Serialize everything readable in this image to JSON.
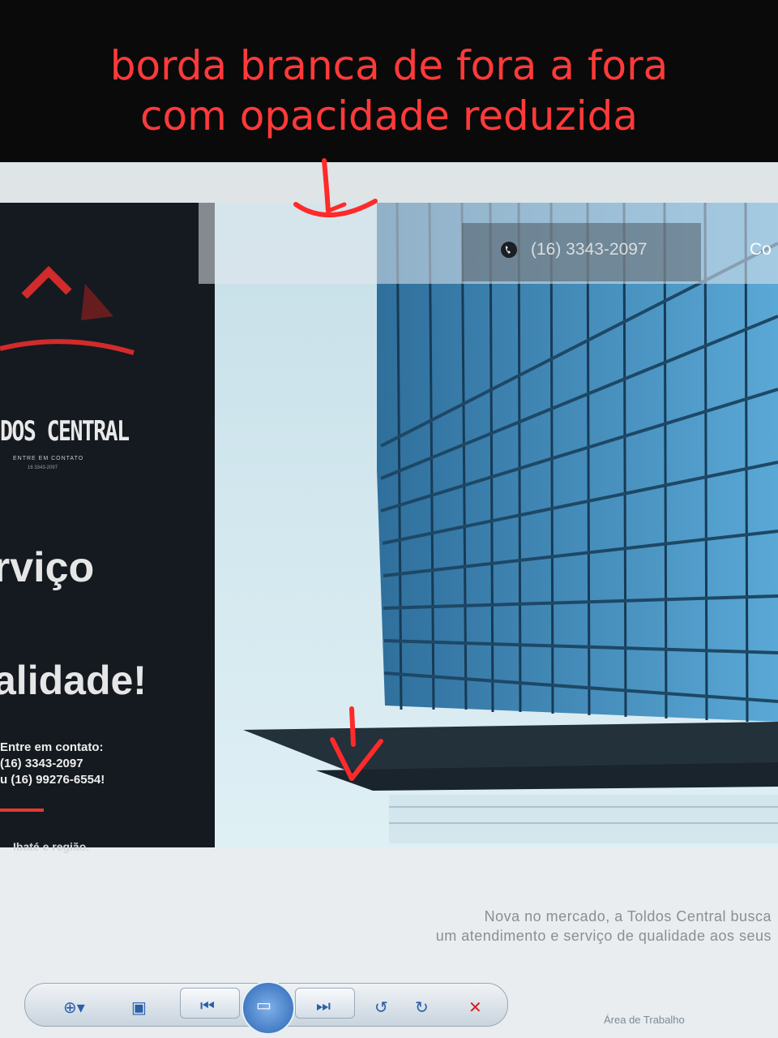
{
  "annotation": {
    "line1": "borda branca de fora a fora",
    "line2": "com opacidade reduzida"
  },
  "sidebar": {
    "brand": "DOS CENTRAL",
    "brand_sub": "ENTRE EM CONTATO",
    "brand_phone": "16 3343-2097",
    "hero_line1": "rviço",
    "hero_line2": "alidade!",
    "contact_title": "Entre em contato:",
    "contact_phone1": " (16) 3343-2097",
    "contact_phone2": "u (16) 99276-6554!",
    "region": "Ibaté e região."
  },
  "header": {
    "phone": "(16) 3343-2097",
    "cta_partial": "Co"
  },
  "intro": {
    "line1": "Nova no mercado, a Toldos Central busca",
    "line2": "um atendimento e serviço de qualidade aos seus"
  },
  "player": {
    "icons": [
      "zoom-icon",
      "fit-icon",
      "previous-icon",
      "slideshow-icon",
      "next-icon",
      "rotate-left-icon",
      "rotate-right-icon",
      "delete-icon"
    ]
  },
  "taskbar": {
    "label": "Área de Trabalho"
  },
  "colors": {
    "annotation": "#ff3a3a",
    "sidebar_bg": "#141a20",
    "accent_red": "#e33a33",
    "building_blue": "#3f86b8"
  }
}
